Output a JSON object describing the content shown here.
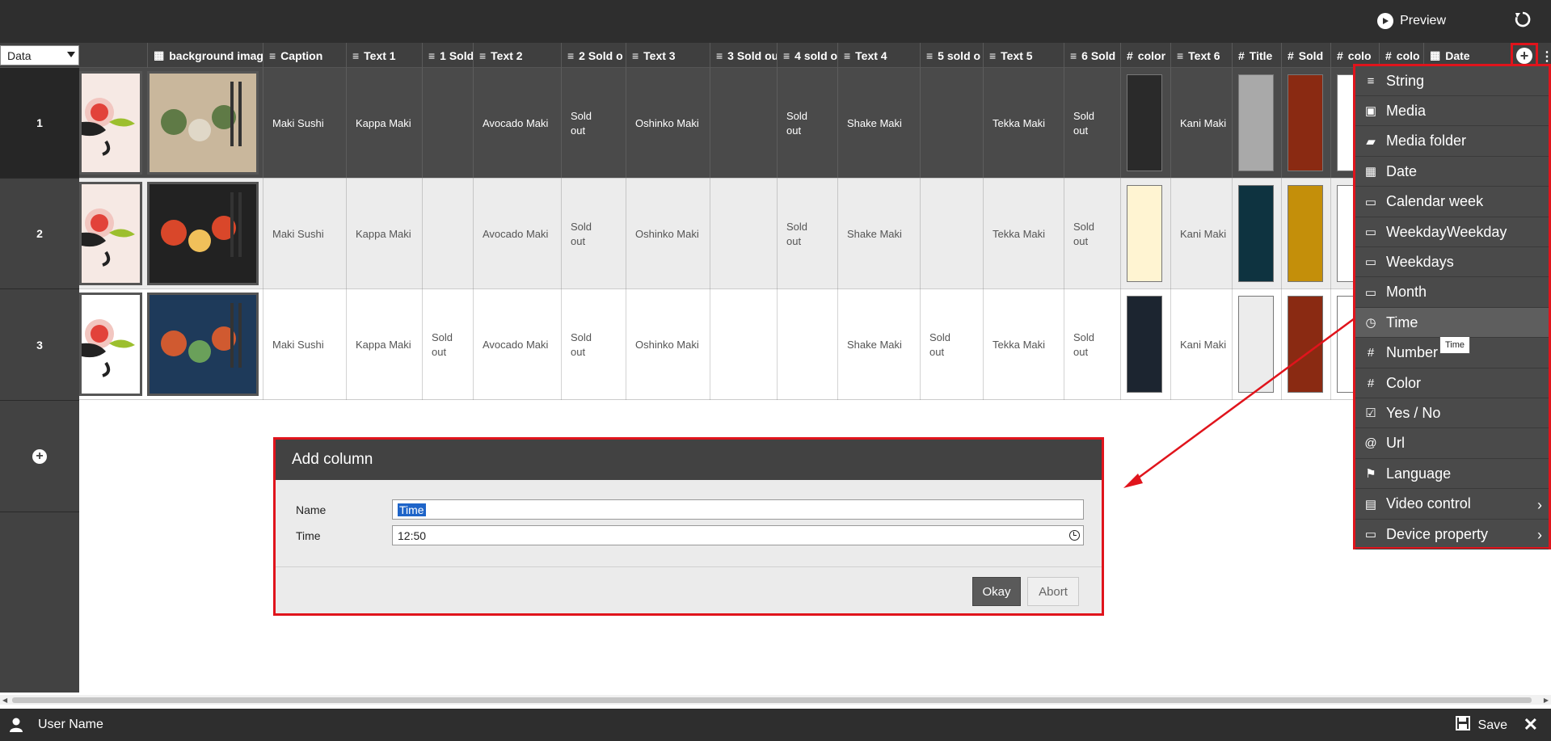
{
  "topbar": {
    "preview_label": "Preview"
  },
  "view_select": {
    "value": "Data"
  },
  "columns": [
    {
      "icon": "▦",
      "icon_name": "image-icon",
      "label": "background image"
    },
    {
      "icon": "≡",
      "icon_name": "text-icon",
      "label": "Caption"
    },
    {
      "icon": "≡",
      "icon_name": "text-icon",
      "label": "Text 1"
    },
    {
      "icon": "≡",
      "icon_name": "text-icon",
      "label": "1 Sold"
    },
    {
      "icon": "≡",
      "icon_name": "text-icon",
      "label": "Text 2"
    },
    {
      "icon": "≡",
      "icon_name": "text-icon",
      "label": "2 Sold o"
    },
    {
      "icon": "≡",
      "icon_name": "text-icon",
      "label": "Text 3"
    },
    {
      "icon": "≡",
      "icon_name": "text-icon",
      "label": "3 Sold ou"
    },
    {
      "icon": "≡",
      "icon_name": "text-icon",
      "label": "4 sold o"
    },
    {
      "icon": "≡",
      "icon_name": "text-icon",
      "label": "Text 4"
    },
    {
      "icon": "≡",
      "icon_name": "text-icon",
      "label": "5 sold o"
    },
    {
      "icon": "≡",
      "icon_name": "text-icon",
      "label": "Text 5"
    },
    {
      "icon": "≡",
      "icon_name": "text-icon",
      "label": "6 Sold"
    },
    {
      "icon": "#",
      "icon_name": "hash-icon",
      "label": "color"
    },
    {
      "icon": "≡",
      "icon_name": "text-icon",
      "label": "Text 6"
    },
    {
      "icon": "#",
      "icon_name": "hash-icon",
      "label": "Title"
    },
    {
      "icon": "#",
      "icon_name": "hash-icon",
      "label": "Sold"
    },
    {
      "icon": "#",
      "icon_name": "hash-icon",
      "label": "colo"
    },
    {
      "icon": "#",
      "icon_name": "hash-icon",
      "label": "colo"
    },
    {
      "icon": "▦",
      "icon_name": "calendar-icon",
      "label": "Date"
    }
  ],
  "rows": [
    {
      "num": "1",
      "caption": "Maki Sushi",
      "text1": "Kappa Maki",
      "sold1": "",
      "text2": "Avocado Maki",
      "sold2": "Sold out",
      "text3": "Oshinko Maki",
      "sold3": "",
      "sold4": "Sold out",
      "text4": "Shake Maki",
      "sold5": "",
      "text5": "Tekka Maki",
      "sold6": "Sold out",
      "color": "#2a2a2a",
      "text6": "Kani Maki",
      "title_color": "#a9a9a9",
      "sold_color": "#8a2a12",
      "colo1": "",
      "colo2": "",
      "photo_colors": [
        "#c9b79c",
        "#5f7a46",
        "#e0d8c8"
      ]
    },
    {
      "num": "2",
      "caption": "Maki Sushi",
      "text1": "Kappa Maki",
      "sold1": "",
      "text2": "Avocado Maki",
      "sold2": "Sold out",
      "text3": "Oshinko Maki",
      "sold3": "",
      "sold4": "Sold out",
      "text4": "Shake Maki",
      "sold5": "",
      "text5": "Tekka Maki",
      "sold6": "Sold out",
      "color": "#fff4d2",
      "text6": "Kani Maki",
      "title_color": "#0e3340",
      "sold_color": "#c48f0a",
      "colo1": "",
      "colo2": "",
      "photo_colors": [
        "#222222",
        "#d9472a",
        "#f0c05a"
      ]
    },
    {
      "num": "3",
      "caption": "Maki Sushi",
      "text1": "Kappa Maki",
      "sold1": "Sold out",
      "text2": "Avocado Maki",
      "sold2": "Sold out",
      "text3": "Oshinko Maki",
      "sold3": "",
      "sold4": "",
      "text4": "Shake Maki",
      "sold5": "Sold out",
      "text5": "Tekka Maki",
      "sold6": "Sold out",
      "color": "#1c2530",
      "text6": "Kani Maki",
      "title_color": "#ececec",
      "sold_color": "#8a2a12",
      "colo1": "",
      "colo2": "",
      "photo_colors": [
        "#1e3a5a",
        "#d05a30",
        "#6aa05a"
      ]
    }
  ],
  "dialog": {
    "title": "Add column",
    "name_label": "Name",
    "name_value": "Time",
    "time_label": "Time",
    "time_value": "12:50",
    "okay_label": "Okay",
    "abort_label": "Abort"
  },
  "menu": {
    "items": [
      {
        "label": "String",
        "icon": "≡",
        "icon_name": "text-icon"
      },
      {
        "label": "Media",
        "icon": "▣",
        "icon_name": "image-icon"
      },
      {
        "label": "Media folder",
        "icon": "▰",
        "icon_name": "folder-open-icon"
      },
      {
        "label": "Date",
        "icon": "▦",
        "icon_name": "calendar-icon"
      },
      {
        "label": "Calendar week",
        "icon": "▭",
        "icon_name": "calendar-outline-icon"
      },
      {
        "label": "WeekdayWeekday",
        "icon": "▭",
        "icon_name": "calendar-outline-icon"
      },
      {
        "label": "Weekdays",
        "icon": "▭",
        "icon_name": "calendar-outline-icon"
      },
      {
        "label": "Month",
        "icon": "▭",
        "icon_name": "calendar-outline-icon"
      },
      {
        "label": "Time",
        "icon": "◷",
        "icon_name": "clock-icon"
      },
      {
        "label": "Number",
        "icon": "#",
        "icon_name": "hash-icon"
      },
      {
        "label": "Color",
        "icon": "#",
        "icon_name": "hash-icon"
      },
      {
        "label": "Yes / No",
        "icon": "☑",
        "icon_name": "checkbox-icon"
      },
      {
        "label": "Url",
        "icon": "@",
        "icon_name": "at-icon"
      },
      {
        "label": "Language",
        "icon": "⚑",
        "icon_name": "flag-icon"
      },
      {
        "label": "Video control",
        "icon": "▤",
        "icon_name": "film-icon",
        "submenu": true
      },
      {
        "label": "Device property",
        "icon": "▭",
        "icon_name": "monitor-icon",
        "submenu": true
      }
    ],
    "highlighted": "Time",
    "tooltip": "Time"
  },
  "bottombar": {
    "user_name": "User Name",
    "save_label": "Save"
  },
  "colors": {
    "accent_red": "#e0141c",
    "dark_bar": "#2e2e2e",
    "header": "#3f3f3f",
    "selection": "#1e64c8"
  }
}
